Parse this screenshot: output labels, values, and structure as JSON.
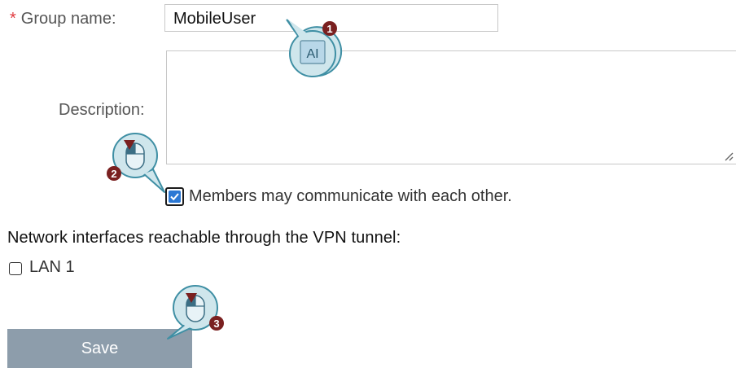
{
  "form": {
    "required_marker": "*",
    "group_name_label": "Group name:",
    "group_name_value": "MobileUser",
    "description_label": "Description:",
    "description_value": "",
    "members_checkbox_label": "Members may communicate with each other.",
    "members_checkbox_checked": true
  },
  "interfaces": {
    "heading": "Network interfaces reachable through the VPN tunnel:",
    "items": [
      {
        "label": "LAN 1",
        "checked": false
      }
    ]
  },
  "save_label": "Save",
  "callouts": [
    {
      "number": "1",
      "icon": "text-cursor-icon"
    },
    {
      "number": "2",
      "icon": "mouse-click-icon"
    },
    {
      "number": "3",
      "icon": "mouse-click-icon"
    }
  ],
  "colors": {
    "required": "#e0393e",
    "checkbox_accent": "#2b78d4",
    "save_button": "#8d9dab",
    "callout_fill": "#cfe6ec",
    "callout_stroke": "#3f8fa4",
    "badge": "#7a2020"
  }
}
